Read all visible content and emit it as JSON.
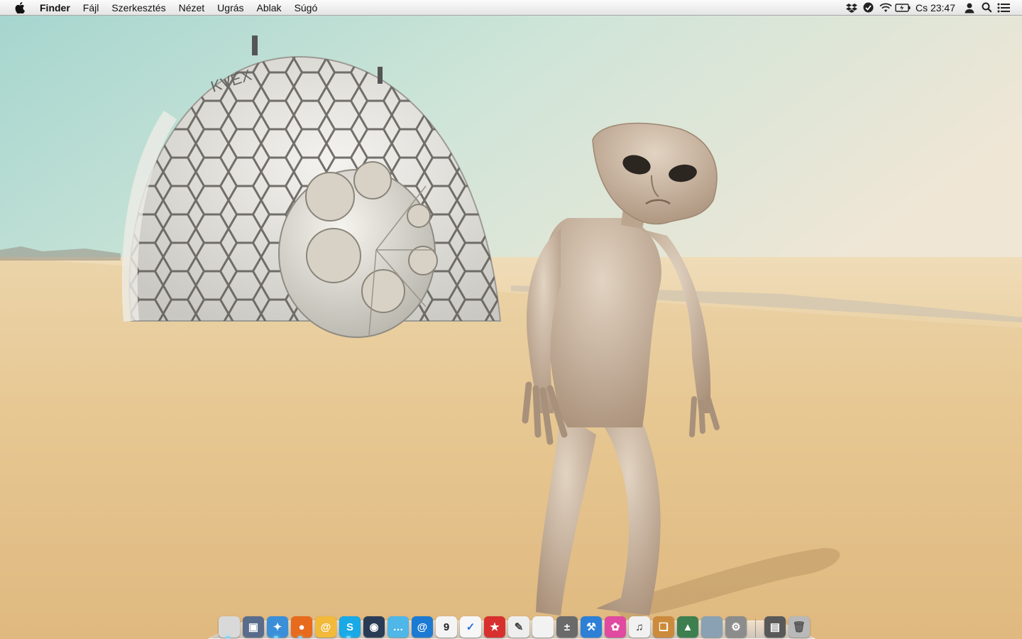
{
  "menubar": {
    "app_name": "Finder",
    "menus": [
      "Fájl",
      "Szerkesztés",
      "Nézet",
      "Ugrás",
      "Ablak",
      "Súgó"
    ],
    "status_icons": [
      "dropbox-icon",
      "evernote-icon",
      "wifi-icon",
      "battery-icon"
    ],
    "clock": "Cs 23:47",
    "right_icons": [
      "user-icon",
      "spotlight-icon",
      "notification-center-icon"
    ]
  },
  "dock": {
    "apps": [
      {
        "name": "finder",
        "glyph": "",
        "color": "#d9d9d9"
      },
      {
        "name": "disk-utility",
        "glyph": "▣",
        "color": "#5a6c8c"
      },
      {
        "name": "safari",
        "glyph": "✦",
        "color": "#3a8fd8"
      },
      {
        "name": "firefox",
        "glyph": "●",
        "color": "#e86a1d"
      },
      {
        "name": "mail",
        "glyph": "@",
        "color": "#f2b93b"
      },
      {
        "name": "skype",
        "glyph": "S",
        "color": "#18a9e6"
      },
      {
        "name": "camera",
        "glyph": "◉",
        "color": "#2a3b55"
      },
      {
        "name": "messages",
        "glyph": "…",
        "color": "#4fb6e8"
      },
      {
        "name": "contacts",
        "glyph": "@",
        "color": "#1c7ad3"
      },
      {
        "name": "calendar",
        "glyph": "9",
        "color": "#f4f4f4"
      },
      {
        "name": "reminders",
        "glyph": "✓",
        "color": "#f7f7f7"
      },
      {
        "name": "wunderlist",
        "glyph": "★",
        "color": "#d8302e"
      },
      {
        "name": "textedit",
        "glyph": "✎",
        "color": "#eeeeee"
      },
      {
        "name": "generic-app",
        "glyph": "",
        "color": "#f2f2f2"
      },
      {
        "name": "calculator",
        "glyph": "±",
        "color": "#6a6a6a"
      },
      {
        "name": "xcode",
        "glyph": "⚒",
        "color": "#2d80d6"
      },
      {
        "name": "photo-booth",
        "glyph": "✿",
        "color": "#e04aa0"
      },
      {
        "name": "itunes",
        "glyph": "♫",
        "color": "#f1f1f1"
      },
      {
        "name": "ibooks",
        "glyph": "❑",
        "color": "#cc8a3c"
      },
      {
        "name": "iphoto",
        "glyph": "▲",
        "color": "#3e7f4f"
      },
      {
        "name": "app-store",
        "glyph": "",
        "color": "#8aa1b3"
      },
      {
        "name": "system-preferences",
        "glyph": "⚙",
        "color": "#8c8c8c"
      }
    ],
    "stacks": [
      {
        "name": "downloads-stack",
        "glyph": "▤",
        "color": "#595959"
      },
      {
        "name": "trash",
        "glyph": "🗑",
        "color": "#b9b9b9"
      }
    ]
  }
}
